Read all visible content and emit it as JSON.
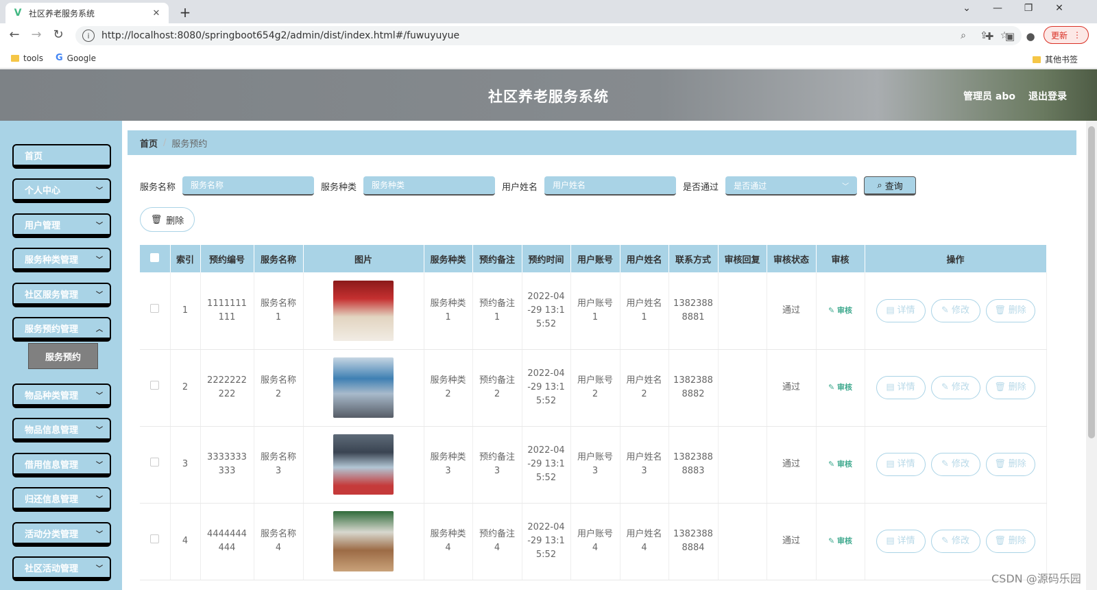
{
  "browser": {
    "tab_title": "社区养老服务系统",
    "url": "http://localhost:8080/springboot654g2/admin/dist/index.html#/fuwuyuyue",
    "update_label": "更新",
    "bookmarks": [
      {
        "label": "tools",
        "icon": "folder-icon"
      },
      {
        "label": "Google",
        "icon": "google-icon"
      }
    ],
    "other_bookmarks": "其他书签"
  },
  "header": {
    "title": "社区养老服务系统",
    "admin_label": "管理员 abo",
    "logout_label": "退出登录"
  },
  "sidebar": {
    "items": [
      {
        "label": "首页",
        "has_chevron": false
      },
      {
        "label": "个人中心",
        "has_chevron": true
      },
      {
        "label": "用户管理",
        "has_chevron": true
      },
      {
        "label": "服务种类管理",
        "has_chevron": true
      },
      {
        "label": "社区服务管理",
        "has_chevron": true
      },
      {
        "label": "服务预约管理",
        "has_chevron": true
      },
      {
        "label": "物品种类管理",
        "has_chevron": true
      },
      {
        "label": "物品信息管理",
        "has_chevron": true
      },
      {
        "label": "借用信息管理",
        "has_chevron": true
      },
      {
        "label": "归还信息管理",
        "has_chevron": true
      },
      {
        "label": "活动分类管理",
        "has_chevron": true
      },
      {
        "label": "社区活动管理",
        "has_chevron": true
      }
    ],
    "active_sub_item": "服务预约"
  },
  "breadcrumb": {
    "home": "首页",
    "current": "服务预约"
  },
  "search": {
    "fields": [
      {
        "label": "服务名称",
        "placeholder": "服务名称"
      },
      {
        "label": "服务种类",
        "placeholder": "服务种类"
      },
      {
        "label": "用户姓名",
        "placeholder": "用户姓名"
      }
    ],
    "select": {
      "label": "是否通过",
      "placeholder": "是否通过"
    },
    "query_label": "查询"
  },
  "delete_label": "删除",
  "table": {
    "headers": [
      "索引",
      "预约编号",
      "服务名称",
      "图片",
      "服务种类",
      "预约备注",
      "预约时间",
      "用户账号",
      "用户姓名",
      "联系方式",
      "审核回复",
      "审核状态",
      "审核",
      "操作"
    ],
    "rows": [
      {
        "index": "1",
        "code": "1111111111",
        "name": "服务名称1",
        "type": "服务种类1",
        "note": "预约备注1",
        "time": "2022-04-29 13:15:52",
        "account": "用户账号1",
        "username": "用户姓名1",
        "phone": "13823888881",
        "reply": "",
        "status": "通过"
      },
      {
        "index": "2",
        "code": "2222222222",
        "name": "服务名称2",
        "type": "服务种类2",
        "note": "预约备注2",
        "time": "2022-04-29 13:15:52",
        "account": "用户账号2",
        "username": "用户姓名2",
        "phone": "13823888882",
        "reply": "",
        "status": "通过"
      },
      {
        "index": "3",
        "code": "3333333333",
        "name": "服务名称3",
        "type": "服务种类3",
        "note": "预约备注3",
        "time": "2022-04-29 13:15:52",
        "account": "用户账号3",
        "username": "用户姓名3",
        "phone": "13823888883",
        "reply": "",
        "status": "通过"
      },
      {
        "index": "4",
        "code": "4444444444",
        "name": "服务名称4",
        "type": "服务种类4",
        "note": "预约备注4",
        "time": "2022-04-29 13:15:52",
        "account": "用户账号4",
        "username": "用户姓名4",
        "phone": "13823888884",
        "reply": "",
        "status": "通过"
      }
    ],
    "audit_label": "审核",
    "op_labels": {
      "detail": "详情",
      "edit": "修改",
      "delete": "删除"
    }
  },
  "watermark": "CSDN @源码乐园",
  "colors": {
    "accent": "#a9d3e6",
    "header_bg": "#868b8f",
    "active_sub_bg": "#808080",
    "audit_link": "#3fa98e"
  }
}
